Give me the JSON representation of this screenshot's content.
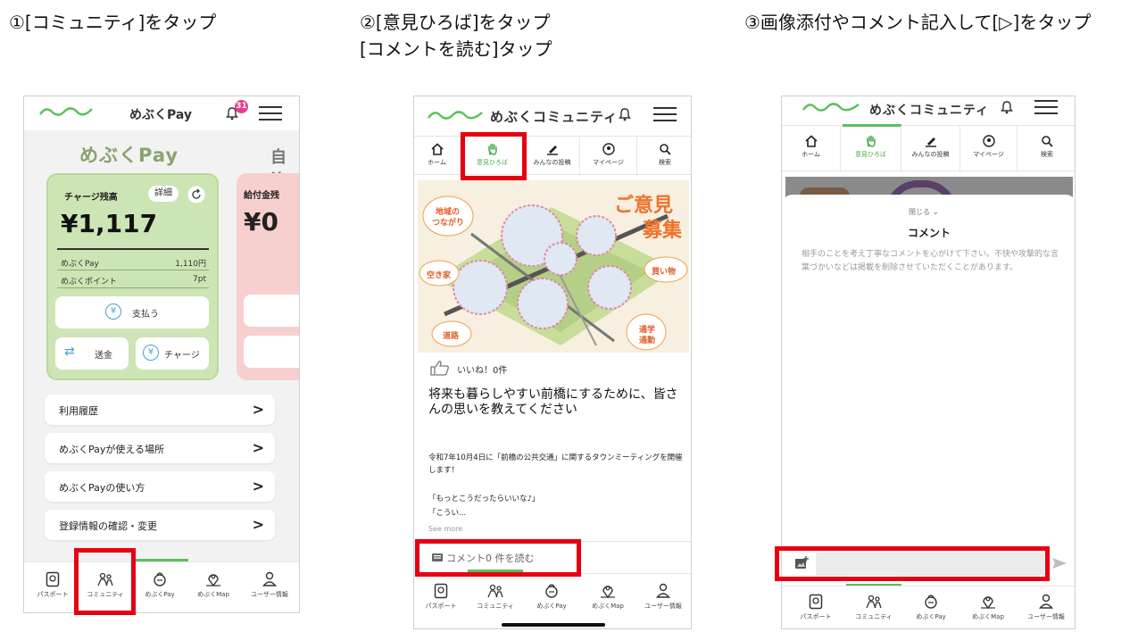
{
  "steps": [
    {
      "title": "①[コミュニティ]をタップ"
    },
    {
      "title": "②[意見ひろば]をタップ",
      "title2": "[コメントを読む]タップ"
    },
    {
      "title": "③画像添付やコメント記入して[▷]をタップ"
    }
  ],
  "colors": {
    "accent_green": "#5bbf59",
    "highlight_red": "#e60012",
    "pay_card": "#cde5b4",
    "badge": "#e83a8a"
  },
  "phone1": {
    "header": {
      "title": "めぶくPay",
      "badge": "31"
    },
    "heading": "めぶくPay",
    "heading2": "自治",
    "card": {
      "label": "チャージ残高",
      "detail_button": "詳細",
      "amount": "¥1,117",
      "rows": [
        {
          "label": "めぶくPay",
          "value": "1,110円"
        },
        {
          "label": "めぶくポイント",
          "value": "7pt"
        }
      ],
      "pay_button": "支払う",
      "send_button": "送金",
      "charge_button": "チャージ"
    },
    "card2": {
      "label": "給付金残",
      "amount": "¥0"
    },
    "menu": [
      "利用履歴",
      "めぶくPayが使える場所",
      "めぶくPayの使い方",
      "登録情報の確認・変更"
    ],
    "nav": [
      "パスポート",
      "コミュニティ",
      "めぶくPay",
      "めぶくMap",
      "ユーザー情報"
    ]
  },
  "phone2": {
    "header": {
      "title": "めぶくコミュニティ"
    },
    "tabs": [
      "ホーム",
      "意見ひろば",
      "みんなの投稿",
      "マイページ",
      "検索"
    ],
    "map_labels": {
      "big": "ご意見",
      "big2": "募集",
      "l1": "地域の",
      "l1b": "つながり",
      "l2": "空き家",
      "l3": "道路",
      "r1": "買い物",
      "r2": "通学",
      "r2b": "通勤"
    },
    "like": "いいね！0件",
    "post_title": "将来も暮らしやすい前橋にするために、皆さんの思いを教えてください",
    "body1": "令和7年10月4日に「前橋の公共交通」に関するタウンミーティングを開催します！",
    "body2": "「もっとこうだったらいいな♪」",
    "body3": "「こうい...",
    "see_more": "See more",
    "comment_link": "コメント0 件を読む",
    "nav": [
      "パスポート",
      "コミュニティ",
      "めぶくPay",
      "めぶくMap",
      "ユーザー情報"
    ]
  },
  "phone3": {
    "header": {
      "title": "めぶくコミュニティ"
    },
    "tabs": [
      "ホーム",
      "意見ひろば",
      "みんなの投稿",
      "マイページ",
      "検索"
    ],
    "close": "閉じる",
    "sheet_title": "コメント",
    "desc": "相手のことを考え丁寧なコメントを心がけて下さい。不快や攻撃的な言葉づかいなどは掲載を削除させていただくことがあります。",
    "input_value": "",
    "nav": [
      "パスポート",
      "コミュニティ",
      "めぶくPay",
      "めぶくMap",
      "ユーザー情報"
    ]
  }
}
